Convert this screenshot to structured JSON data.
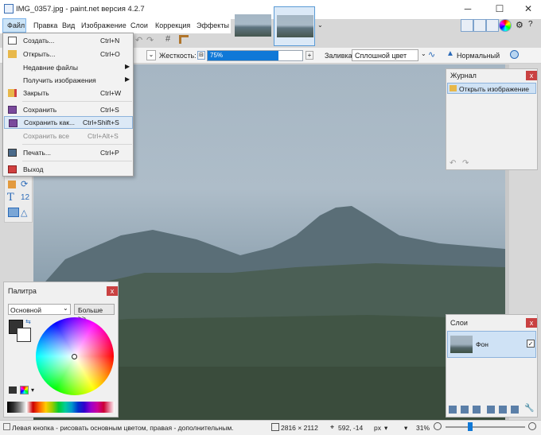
{
  "window": {
    "title": "IMG_0357.jpg - paint.net версия 4.2.7",
    "minimize": "─",
    "maximize": "☐",
    "close": "✕"
  },
  "menu": [
    "Файл",
    "Правка",
    "Вид",
    "Изображение",
    "Слои",
    "Коррекция",
    "Эффекты"
  ],
  "file_menu": [
    {
      "label": "Создать...",
      "shortcut": "Ctrl+N",
      "icon": "new-file-icon"
    },
    {
      "label": "Открыть...",
      "shortcut": "Ctrl+O",
      "icon": "open-folder-icon"
    },
    {
      "label": "Недавние файлы",
      "submenu": true
    },
    {
      "label": "Получить изображения",
      "submenu": true
    },
    {
      "label": "Закрыть",
      "shortcut": "Ctrl+W",
      "icon": "close-file-icon"
    },
    {
      "label": "Сохранить",
      "shortcut": "Ctrl+S",
      "icon": "save-icon"
    },
    {
      "label": "Сохранить как...",
      "shortcut": "Ctrl+Shift+S",
      "icon": "save-as-icon",
      "highlighted": true
    },
    {
      "label": "Сохранить все",
      "shortcut": "Ctrl+Alt+S",
      "disabled": true
    },
    {
      "label": "Печать...",
      "shortcut": "Ctrl+P",
      "icon": "print-icon"
    },
    {
      "label": "Выход",
      "icon": "exit-icon"
    }
  ],
  "toolbar": {
    "hardness_label": "Жесткость:",
    "hardness_value": "75%",
    "hardness_fraction": 0.75,
    "fill_label": "Заливка:",
    "fill_value": "Сплошной цвет",
    "blend_value": "Нормальный"
  },
  "history": {
    "title": "Журнал",
    "items": [
      "Открыть изображение"
    ]
  },
  "layers": {
    "title": "Слои",
    "items": [
      {
        "name": "Фон",
        "visible": true
      }
    ]
  },
  "palette": {
    "title": "Палитра",
    "mode": "Основной",
    "more_button": "Больше >>"
  },
  "status": {
    "hint": "Левая кнопка - рисовать основным цветом, правая - дополнительным.",
    "image_size": "2816 × 2112",
    "cursor": "592, -14",
    "units": "px",
    "zoom": "31%"
  },
  "colors": {
    "accent": "#0f78d7",
    "highlight": "#cfe2f5",
    "close_red": "#c94141"
  }
}
